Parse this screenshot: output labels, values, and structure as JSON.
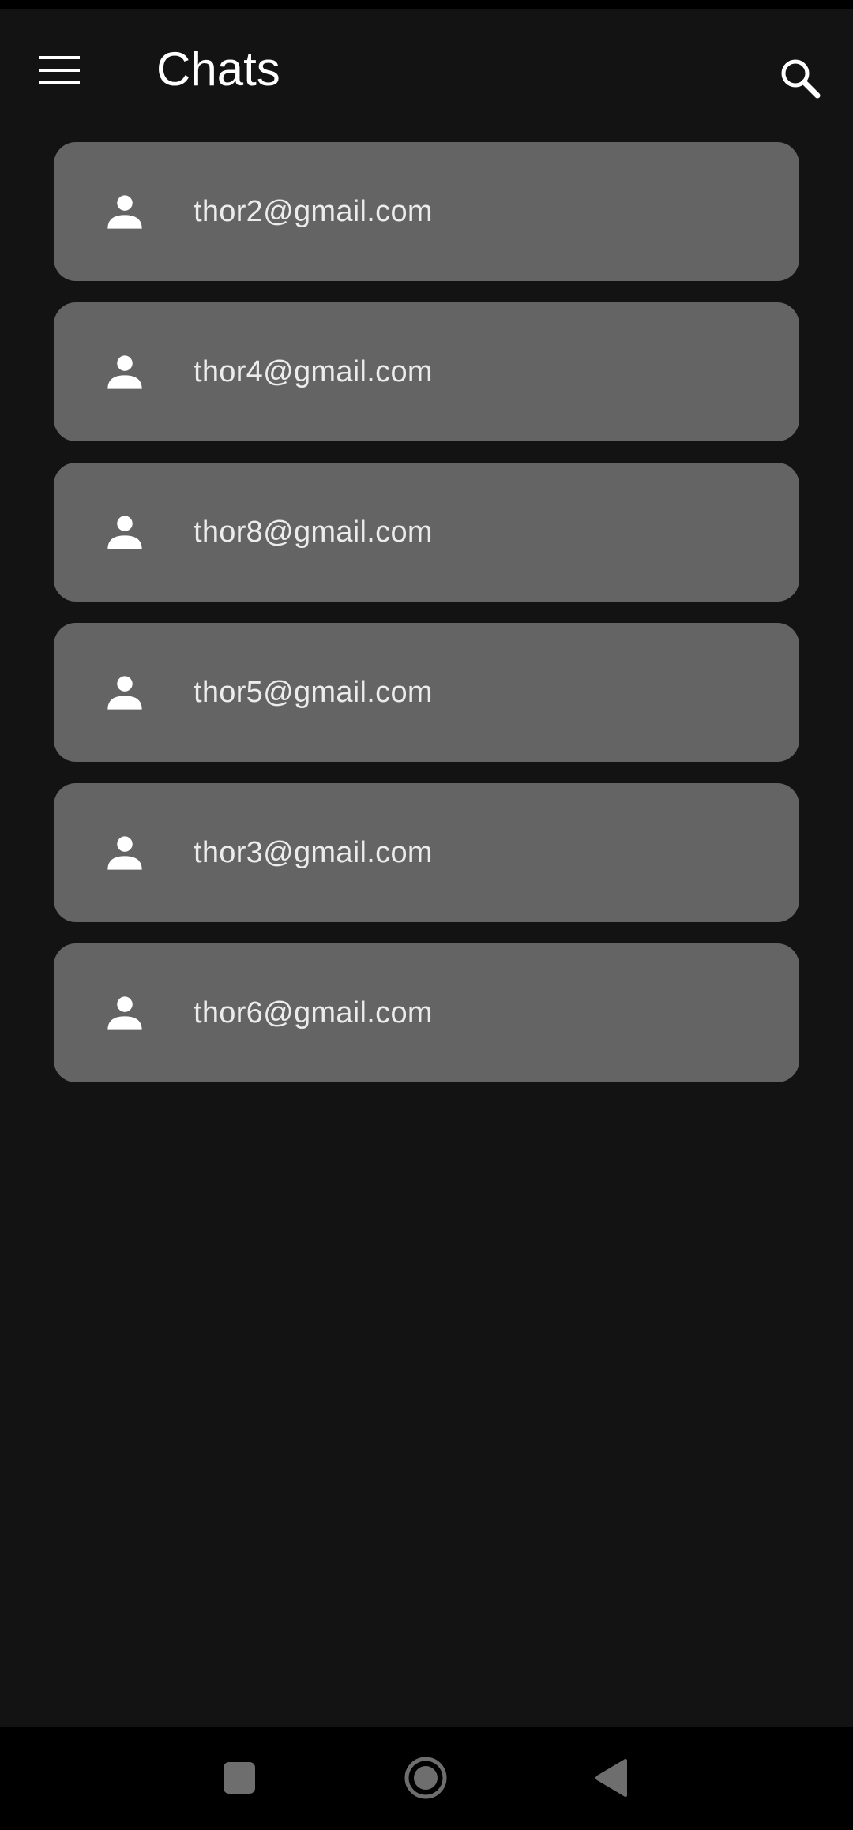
{
  "app_bar": {
    "title": "Chats",
    "menu_icon": "hamburger-menu-icon",
    "search_icon": "search-icon"
  },
  "chats": [
    {
      "label": "thor2@gmail.com",
      "icon": "person-icon"
    },
    {
      "label": "thor4@gmail.com",
      "icon": "person-icon"
    },
    {
      "label": "thor8@gmail.com",
      "icon": "person-icon"
    },
    {
      "label": "thor5@gmail.com",
      "icon": "person-icon"
    },
    {
      "label": "thor3@gmail.com",
      "icon": "person-icon"
    },
    {
      "label": "thor6@gmail.com",
      "icon": "person-icon"
    }
  ],
  "nav_bar": {
    "recents_icon": "square-icon",
    "home_icon": "circle-icon",
    "back_icon": "triangle-back-icon"
  },
  "colors": {
    "background": "#131313",
    "card": "#646464",
    "text": "#ffffff"
  }
}
